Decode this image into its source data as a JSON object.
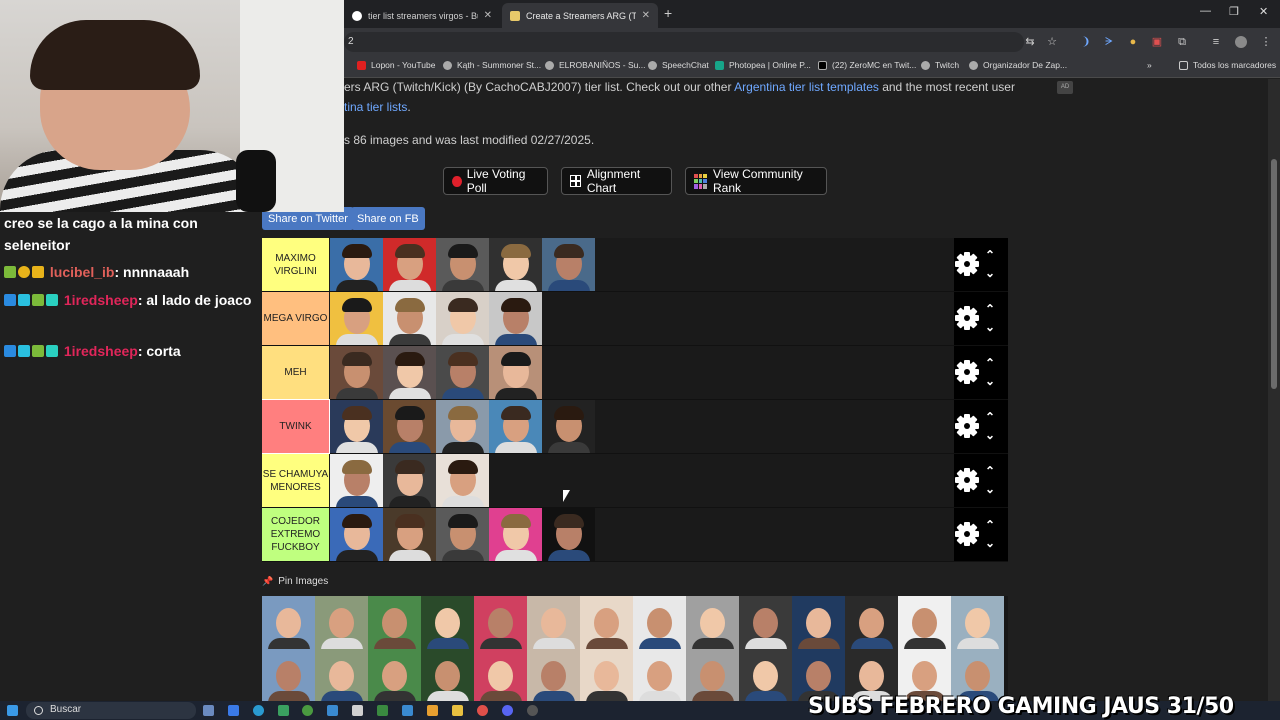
{
  "tabs": [
    {
      "label": "tier list streamers virgos - Busca"
    },
    {
      "label": "Create a Streamers ARG (Twitch/"
    }
  ],
  "address_value": "2",
  "bookmarks": [
    "Lopon - YouTube",
    "Kąth - Summoner St...",
    "ELROBANIÑOS - Su...",
    "SpeechChat",
    "Photopea | Online P...",
    "(22) ZeroMC en Twit...",
    "Twitch",
    "Organizador De Zap..."
  ],
  "bookmarks_folder": "Todos los marcadores",
  "desc": {
    "line1_prefix": "ers ARG (Twitch/Kick) (By CachoCABJ2007) tier list. Check out our other ",
    "line1_link": "Argentina tier list templates",
    "line1_suffix": " and the most recent user",
    "line2_link": "tina tier lists",
    "line2_suffix": ".",
    "line3": "s 86 images and was last modified 02/27/2025."
  },
  "ad_label": "AD",
  "buttons": {
    "live": "Live Voting Poll",
    "alignment": "Alignment Chart",
    "community": "View Community Rank"
  },
  "share": {
    "twitter": "Share on Twitter",
    "fb": "Share on FB"
  },
  "tiers": [
    {
      "label": "MAXIMO VIRGLINI",
      "color": "#ffff7f",
      "count": 5
    },
    {
      "label": "MEGA VIRGO",
      "color": "#ffbf7f",
      "count": 4
    },
    {
      "label": "MEH",
      "color": "#ffdf7f",
      "count": 4
    },
    {
      "label": "TWINK",
      "color": "#ff7f7f",
      "count": 5
    },
    {
      "label": "SE CHAMUYA MENORES",
      "color": "#ffff7f",
      "count": 3
    },
    {
      "label": "COJEDOR EXTREMO FUCKBOY",
      "color": "#bfff7f",
      "count": 5
    }
  ],
  "pin_label": "Pin Images",
  "chat": [
    {
      "user": "",
      "text": "creo se la cago a la mina con seleneitor"
    },
    {
      "user": "lucibel_ib",
      "text": ": nnnnaaah"
    },
    {
      "user": "1iredsheep",
      "text": ": al lado de joaco"
    },
    {
      "user": "1iredsheep",
      "text": ": corta"
    }
  ],
  "taskbar_search": "Buscar",
  "subs_banner": "SUBS FEBRERO GAMING JAUS",
  "subs_count": "31/50"
}
